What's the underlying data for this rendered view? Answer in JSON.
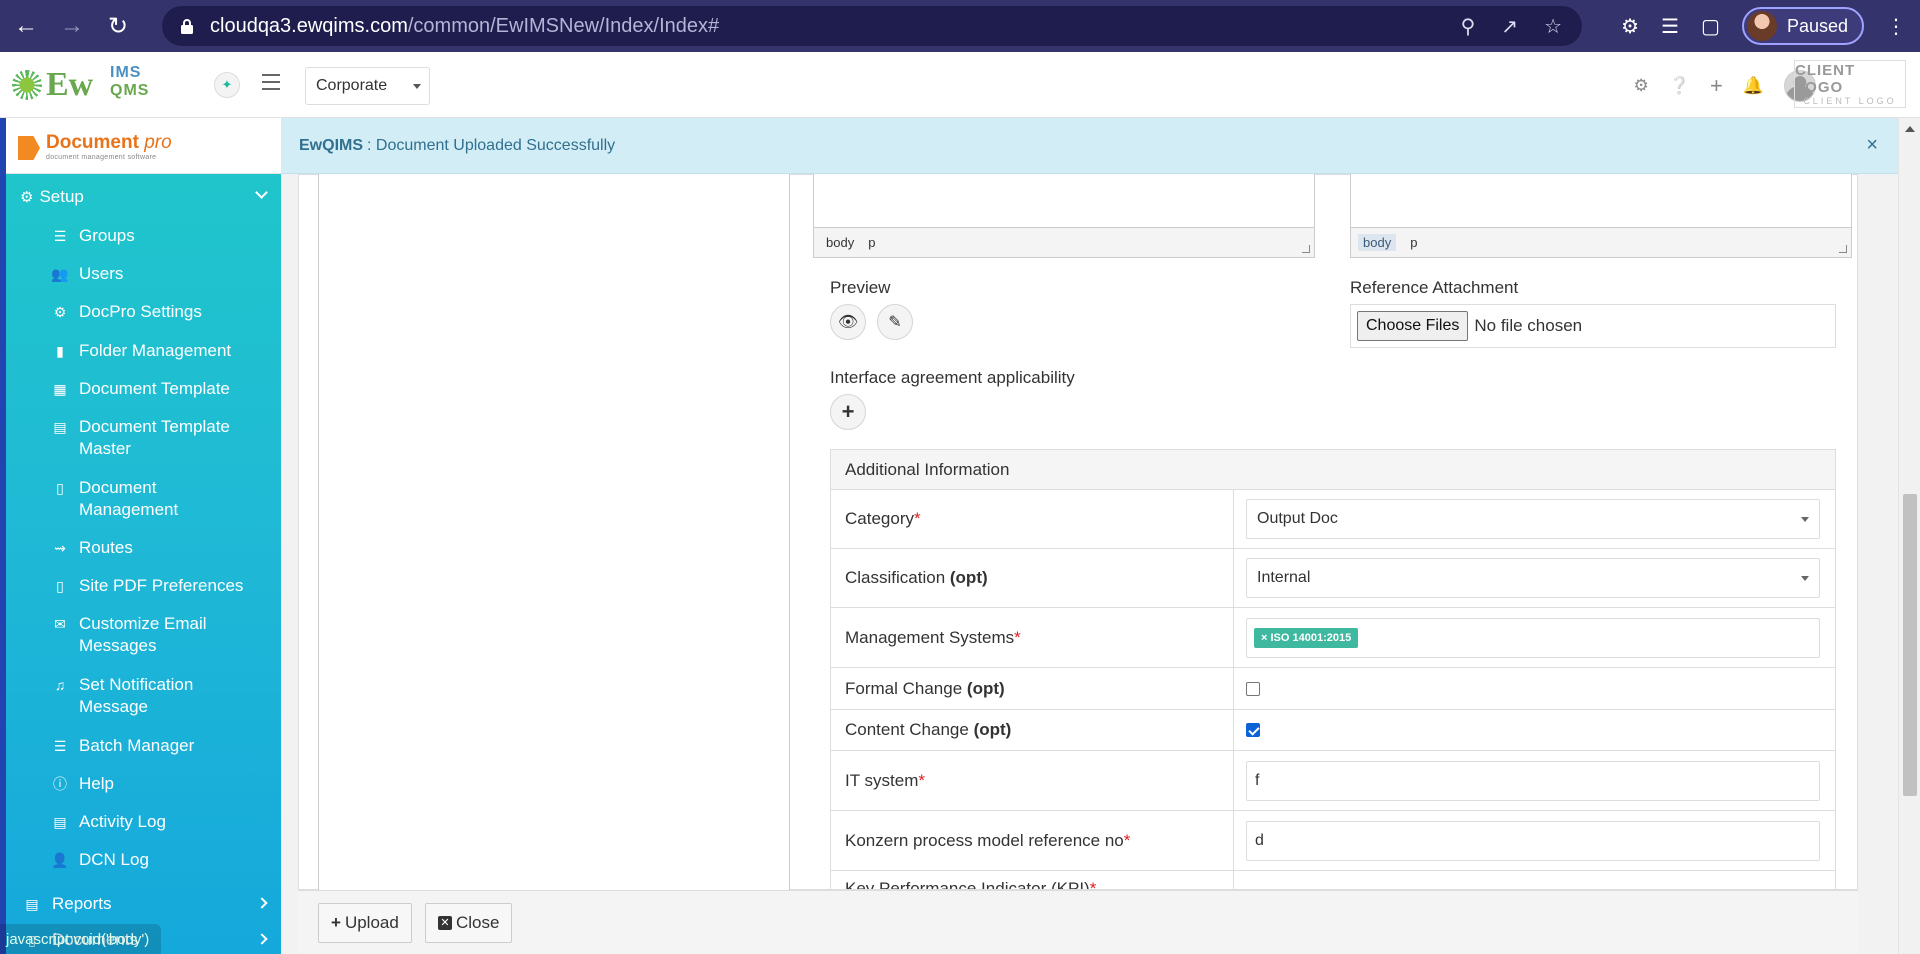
{
  "browser": {
    "url_host": "cloudqa3.ewqims.com",
    "url_path": "/common/EwIMSNew/Index/Index#",
    "profile_status": "Paused"
  },
  "header": {
    "logo_ew": "Ew",
    "logo_ims": "IMS",
    "logo_qms": "QMS",
    "company_select": "Corporate",
    "client_logo_big": "CLIENT LOGO",
    "client_logo_small": "CLIENT LOGO"
  },
  "sidebar": {
    "brand_main": "Document",
    "brand_italic": "pro",
    "brand_sub": "document management software",
    "setup_label": "Setup",
    "items": [
      {
        "label": "Groups"
      },
      {
        "label": "Users"
      },
      {
        "label": "DocPro Settings"
      },
      {
        "label": "Folder Management"
      },
      {
        "label": "Document Template"
      },
      {
        "label": "Document Template Master"
      },
      {
        "label": "Document Management"
      },
      {
        "label": "Routes"
      },
      {
        "label": "Site PDF Preferences"
      },
      {
        "label": "Customize Email Messages"
      },
      {
        "label": "Set Notification Message"
      },
      {
        "label": "Batch Manager"
      },
      {
        "label": "Help"
      },
      {
        "label": "Activity Log"
      },
      {
        "label": "DCN Log"
      }
    ],
    "reports_label": "Reports",
    "documents_label": "Documents",
    "status_url": "javascript:void('body')"
  },
  "notice": {
    "app": "EwQIMS",
    "message": ": Document Uploaded Successfully",
    "close": "×"
  },
  "editors": {
    "left_path": [
      "body",
      "p"
    ],
    "right_path": [
      "body",
      "p"
    ]
  },
  "form": {
    "preview_label": "Preview",
    "reference_label": "Reference Attachment",
    "choose_files": "Choose Files",
    "no_file": "No file chosen",
    "interface_label": "Interface agreement applicability",
    "additional_title": "Additional Information",
    "category_label": "Category",
    "category_value": "Output Doc",
    "classification_label": "Classification",
    "classification_value": "Internal",
    "management_label": "Management Systems",
    "management_tag": "× ISO 14001:2015",
    "formal_label": "Formal Change",
    "content_label": "Content Change",
    "opt": "(opt)",
    "req": "*",
    "it_label": "IT system",
    "it_value": "f",
    "konzern_label": "Konzern process model reference no",
    "konzern_value": "d",
    "kpi_label": "Key Performance Indicator (KPI)"
  },
  "footer": {
    "upload": "Upload",
    "close": "Close"
  }
}
